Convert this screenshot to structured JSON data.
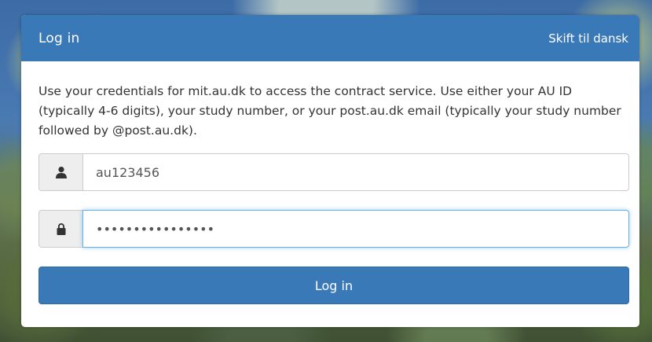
{
  "header": {
    "title": "Log in",
    "language_link": "Skift til dansk"
  },
  "intro_text": "Use your credentials for mit.au.dk to access the contract service. Use either your AU ID (typically 4-6 digits), your study number, or your post.au.dk email (typically your study number followed by @post.au.dk).",
  "username": {
    "value": "au123456",
    "icon": "user-icon"
  },
  "password": {
    "value": "••••••••••••••••",
    "icon": "lock-icon"
  },
  "submit": {
    "label": "Log in"
  },
  "colors": {
    "primary": "#3a79b8",
    "focus_border": "#66afe9",
    "addon_bg": "#eeeeee"
  }
}
